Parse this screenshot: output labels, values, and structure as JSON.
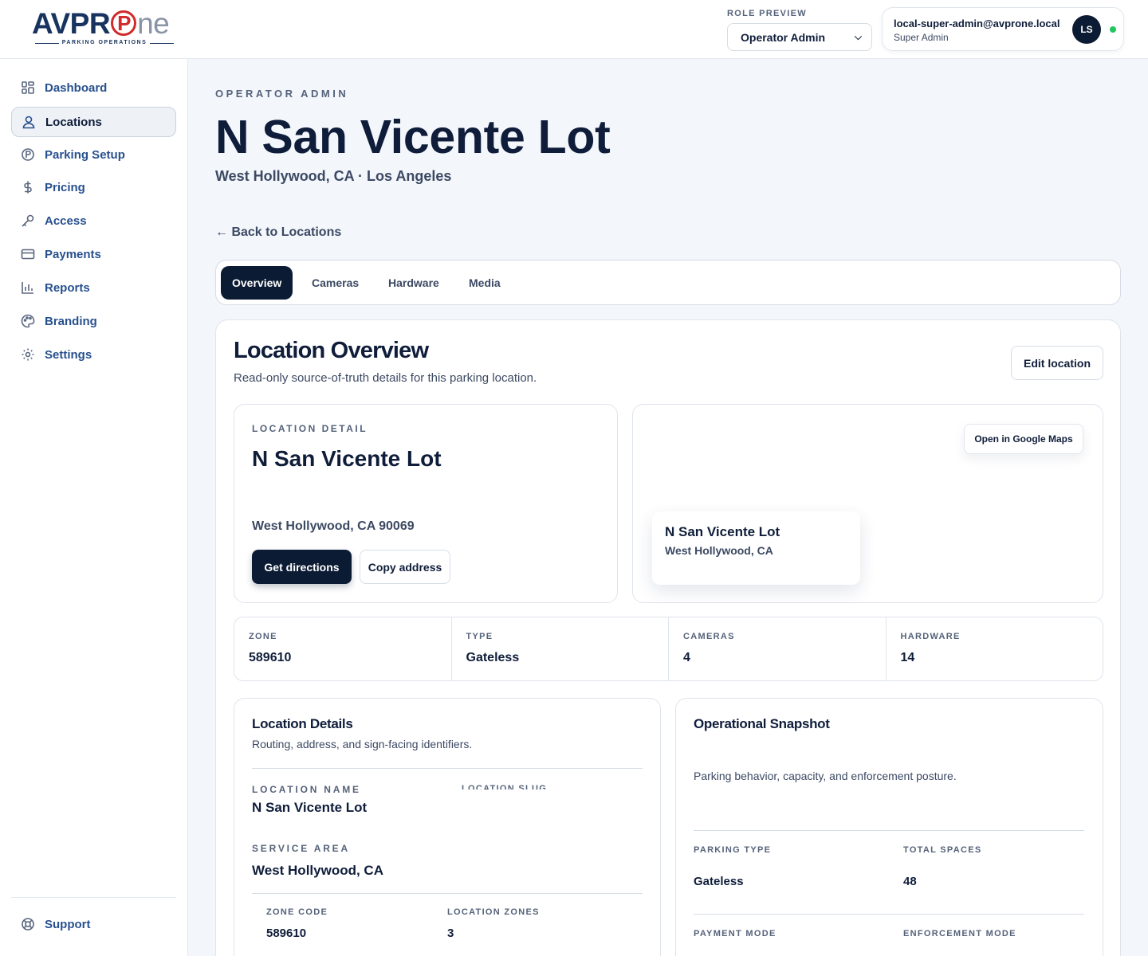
{
  "brand": {
    "logo_text_a": "AVPR",
    "logo_text_b": "ne",
    "logo_tagline": "PARKING OPERATIONS"
  },
  "header": {
    "role_label": "ROLE PREVIEW",
    "role_value": "Operator Admin",
    "user_email": "local-super-admin@avprone.local",
    "user_role": "Super Admin",
    "avatar_initials": "LS",
    "online_color": "#22c55e"
  },
  "sidebar": {
    "items": [
      {
        "label": "Dashboard",
        "icon": "grid-icon"
      },
      {
        "label": "Locations",
        "icon": "user-pin-icon",
        "active": true
      },
      {
        "label": "Parking Setup",
        "icon": "parking-icon"
      },
      {
        "label": "Pricing",
        "icon": "dollar-icon"
      },
      {
        "label": "Access",
        "icon": "key-icon"
      },
      {
        "label": "Payments",
        "icon": "card-icon"
      },
      {
        "label": "Reports",
        "icon": "bar-chart-icon"
      },
      {
        "label": "Branding",
        "icon": "palette-icon"
      },
      {
        "label": "Settings",
        "icon": "gear-icon"
      }
    ],
    "support_label": "Support"
  },
  "page": {
    "eyebrow": "OPERATOR ADMIN",
    "title": "N San Vicente Lot",
    "subtitle": "West Hollywood, CA · Los Angeles",
    "back_link": "← Back to Locations"
  },
  "tabs": [
    "Overview",
    "Cameras",
    "Hardware",
    "Media"
  ],
  "overview": {
    "title": "Location Overview",
    "subtitle": "Read-only source-of-truth details for this parking location.",
    "edit_button": "Edit location",
    "location_detail": {
      "kicker": "LOCATION DETAIL",
      "name": "N San Vicente Lot",
      "address": "West Hollywood, CA 90069",
      "directions_button": "Get directions",
      "copy_button": "Copy address"
    },
    "map": {
      "open_button": "Open in Google Maps",
      "pin_name": "N San Vicente Lot",
      "pin_city": "West Hollywood, CA"
    },
    "stats": [
      {
        "label": "ZONE",
        "value": "589610"
      },
      {
        "label": "TYPE",
        "value": "Gateless"
      },
      {
        "label": "CAMERAS",
        "value": "4"
      },
      {
        "label": "HARDWARE",
        "value": "14"
      }
    ],
    "details": {
      "title": "Location Details",
      "subtitle": "Routing, address, and sign-facing identifiers.",
      "location_name_label": "LOCATION NAME",
      "location_name": "N San Vicente Lot",
      "location_slug_label": "LOCATION SLUG",
      "service_area_label": "SERVICE AREA",
      "service_area": "West Hollywood, CA",
      "zone_code_label": "ZONE CODE",
      "zone_code": "589610",
      "location_zones_label": "LOCATION ZONES",
      "location_zones": "3"
    },
    "snapshot": {
      "title": "Operational Snapshot",
      "subtitle": "Parking behavior, capacity, and enforcement posture.",
      "parking_type_label": "PARKING TYPE",
      "parking_type": "Gateless",
      "total_spaces_label": "TOTAL SPACES",
      "total_spaces": "48",
      "payment_mode_label": "PAYMENT MODE",
      "enforcement_mode_label": "ENFORCEMENT MODE"
    }
  }
}
